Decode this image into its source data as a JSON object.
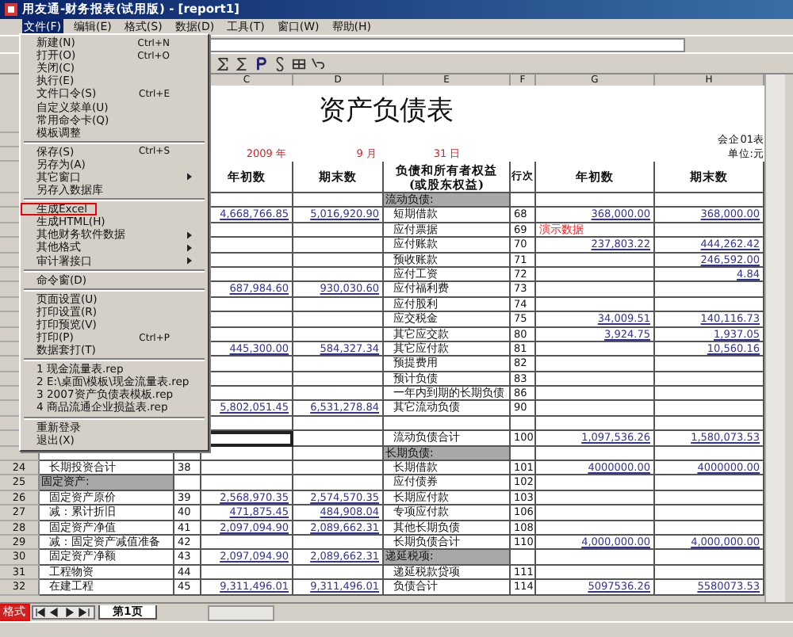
{
  "window": {
    "title": "用友通-财务报表(试用版) - [report1]"
  },
  "menubar": [
    {
      "label": "文件(F)",
      "selected": true
    },
    {
      "label": "编辑(E)",
      "selected": false
    },
    {
      "label": "格式(S)",
      "selected": false
    },
    {
      "label": "数据(D)",
      "selected": false
    },
    {
      "label": "工具(T)",
      "selected": false
    },
    {
      "label": "窗口(W)",
      "selected": false
    },
    {
      "label": "帮助(H)",
      "selected": false
    }
  ],
  "file_menu": [
    {
      "kind": "item",
      "label": "新建(N)",
      "shortcut": "Ctrl+N",
      "submenu": false,
      "highlighted": false
    },
    {
      "kind": "item",
      "label": "打开(O)",
      "shortcut": "Ctrl+O",
      "submenu": false,
      "highlighted": false
    },
    {
      "kind": "item",
      "label": "关闭(C)",
      "submenu": false,
      "highlighted": false
    },
    {
      "kind": "item",
      "label": "执行(E)",
      "submenu": false,
      "highlighted": false
    },
    {
      "kind": "item",
      "label": "文件口令(S)",
      "shortcut": "Ctrl+E",
      "submenu": false,
      "highlighted": false
    },
    {
      "kind": "item",
      "label": "自定义菜单(U)",
      "submenu": false,
      "highlighted": false
    },
    {
      "kind": "item",
      "label": "常用命令卡(Q)",
      "submenu": false,
      "highlighted": false
    },
    {
      "kind": "item",
      "label": "模板调整",
      "submenu": false,
      "highlighted": false
    },
    {
      "kind": "separator"
    },
    {
      "kind": "item",
      "label": "保存(S)",
      "shortcut": "Ctrl+S",
      "submenu": false,
      "highlighted": false
    },
    {
      "kind": "item",
      "label": "另存为(A)",
      "submenu": false,
      "highlighted": false
    },
    {
      "kind": "item",
      "label": "其它窗口",
      "submenu": true,
      "highlighted": false
    },
    {
      "kind": "item",
      "label": "另存入数据库",
      "submenu": false,
      "highlighted": false
    },
    {
      "kind": "separator"
    },
    {
      "kind": "item",
      "label": "生成Excel",
      "submenu": false,
      "highlighted": true
    },
    {
      "kind": "item",
      "label": "生成HTML(H)",
      "submenu": false,
      "highlighted": false
    },
    {
      "kind": "item",
      "label": "其他财务软件数据",
      "submenu": true,
      "highlighted": false
    },
    {
      "kind": "item",
      "label": "其他格式",
      "submenu": true,
      "highlighted": false
    },
    {
      "kind": "item",
      "label": "审计署接口",
      "submenu": true,
      "highlighted": false
    },
    {
      "kind": "separator"
    },
    {
      "kind": "item",
      "label": "命令窗(D)",
      "submenu": false,
      "highlighted": false
    },
    {
      "kind": "separator"
    },
    {
      "kind": "item",
      "label": "页面设置(U)",
      "submenu": false,
      "highlighted": false
    },
    {
      "kind": "item",
      "label": "打印设置(R)",
      "submenu": false,
      "highlighted": false
    },
    {
      "kind": "item",
      "label": "打印预览(V)",
      "submenu": false,
      "highlighted": false
    },
    {
      "kind": "item",
      "label": "打印(P)",
      "shortcut": "Ctrl+P",
      "submenu": false,
      "highlighted": false
    },
    {
      "kind": "item",
      "label": "数据套打(T)",
      "submenu": false,
      "highlighted": false
    },
    {
      "kind": "separator"
    },
    {
      "kind": "item",
      "label": "1 现金流量表.rep",
      "submenu": false,
      "highlighted": false
    },
    {
      "kind": "item",
      "label": "2 E:\\桌面\\模板\\现金流量表.rep",
      "submenu": false,
      "highlighted": false
    },
    {
      "kind": "item",
      "label": "3 2007资产负债表模板.rep",
      "submenu": false,
      "highlighted": false
    },
    {
      "kind": "item",
      "label": "4 商品流通企业损益表.rep",
      "submenu": false,
      "highlighted": false
    },
    {
      "kind": "separator"
    },
    {
      "kind": "item",
      "label": "重新登录",
      "submenu": false,
      "highlighted": false
    },
    {
      "kind": "item",
      "label": "退出(X)",
      "submenu": false,
      "highlighted": false
    }
  ],
  "column_headers": [
    "C",
    "D",
    "E",
    "F",
    "G",
    "H"
  ],
  "report": {
    "title": "资产负债表",
    "form_no": "会企01表",
    "year": "2009 年",
    "month": "9 月",
    "day": "31 日",
    "unit": "单位:元",
    "headers": [
      "年初数",
      "期末数",
      "负债和所有者权益",
      "(或股东权益)",
      "行次",
      "年初数",
      "期末数"
    ]
  },
  "rows": [
    {
      "cells": [
        null,
        null,
        null,
        null,
        {
          "kind": "section",
          "text": "流动负债:"
        },
        null,
        null,
        null
      ]
    },
    {
      "cells": [
        null,
        null,
        {
          "kind": "value",
          "text": "4,668,766.85"
        },
        {
          "kind": "value",
          "text": "5,016,920.90"
        },
        {
          "kind": "name",
          "text": "短期借款"
        },
        {
          "kind": "line",
          "text": "68"
        },
        {
          "kind": "value",
          "text": "368,000.00"
        },
        {
          "kind": "value",
          "text": "368,000.00"
        }
      ]
    },
    {
      "cells": [
        null,
        null,
        null,
        null,
        {
          "kind": "name",
          "text": "应付票据"
        },
        {
          "kind": "line",
          "text": "69"
        },
        {
          "kind": "note",
          "text": "演示数据"
        },
        null
      ]
    },
    {
      "cells": [
        null,
        null,
        null,
        null,
        {
          "kind": "name",
          "text": "应付账款"
        },
        {
          "kind": "line",
          "text": "70"
        },
        {
          "kind": "value",
          "text": "237,803.22"
        },
        {
          "kind": "value",
          "text": "444,262.42"
        }
      ]
    },
    {
      "cells": [
        null,
        null,
        null,
        null,
        {
          "kind": "name",
          "text": "预收账款"
        },
        {
          "kind": "line",
          "text": "71"
        },
        null,
        {
          "kind": "value",
          "text": "246,592.00"
        }
      ]
    },
    {
      "cells": [
        null,
        null,
        null,
        null,
        {
          "kind": "name",
          "text": "应付工资"
        },
        {
          "kind": "line",
          "text": "72"
        },
        null,
        {
          "kind": "value",
          "text": "4.84"
        }
      ]
    },
    {
      "cells": [
        null,
        null,
        {
          "kind": "value",
          "text": "687,984.60"
        },
        {
          "kind": "value",
          "text": "930,030.60"
        },
        {
          "kind": "name",
          "text": "应付福利费"
        },
        {
          "kind": "line",
          "text": "73"
        },
        null,
        null
      ]
    },
    {
      "cells": [
        null,
        null,
        null,
        null,
        {
          "kind": "name",
          "text": "应付股利"
        },
        {
          "kind": "line",
          "text": "74"
        },
        null,
        null
      ]
    },
    {
      "cells": [
        null,
        null,
        null,
        null,
        {
          "kind": "name",
          "text": "应交税金"
        },
        {
          "kind": "line",
          "text": "75"
        },
        {
          "kind": "value",
          "text": "34,009.51"
        },
        {
          "kind": "value",
          "text": "140,116.73"
        }
      ]
    },
    {
      "cells": [
        null,
        null,
        null,
        null,
        {
          "kind": "name",
          "text": "其它应交款"
        },
        {
          "kind": "line",
          "text": "80"
        },
        {
          "kind": "value",
          "text": "3,924.75"
        },
        {
          "kind": "value",
          "text": "1,937.05"
        }
      ]
    },
    {
      "cells": [
        null,
        null,
        {
          "kind": "value",
          "text": "445,300.00"
        },
        {
          "kind": "value",
          "text": "584,327.34"
        },
        {
          "kind": "name",
          "text": "其它应付款"
        },
        {
          "kind": "line",
          "text": "81"
        },
        null,
        {
          "kind": "value",
          "text": "10,560.16"
        }
      ]
    },
    {
      "cells": [
        null,
        null,
        null,
        null,
        {
          "kind": "name",
          "text": "预提费用"
        },
        {
          "kind": "line",
          "text": "82"
        },
        null,
        null
      ]
    },
    {
      "cells": [
        null,
        null,
        null,
        null,
        {
          "kind": "name",
          "text": "预计负债"
        },
        {
          "kind": "line",
          "text": "83"
        },
        null,
        null
      ]
    },
    {
      "cells": [
        null,
        null,
        null,
        null,
        {
          "kind": "name",
          "text": "一年内到期的长期负债"
        },
        {
          "kind": "line",
          "text": "86"
        },
        null,
        null
      ]
    },
    {
      "cells": [
        null,
        null,
        {
          "kind": "value",
          "text": "5,802,051.45"
        },
        {
          "kind": "value",
          "text": "6,531,278.84"
        },
        {
          "kind": "name",
          "text": "其它流动负债"
        },
        {
          "kind": "line",
          "text": "90"
        },
        null,
        null
      ]
    },
    {
      "cells": [
        null,
        null,
        null,
        null,
        null,
        null,
        null,
        null
      ]
    },
    {
      "cells": [
        null,
        null,
        {
          "kind": "blank",
          "selected": true
        },
        null,
        {
          "kind": "name",
          "text": "流动负债合计"
        },
        {
          "kind": "line",
          "text": "100"
        },
        {
          "kind": "value",
          "text": "1,097,536.26"
        },
        {
          "kind": "value",
          "text": "1,580,073.53"
        }
      ]
    },
    {
      "cells": [
        null,
        null,
        null,
        null,
        {
          "kind": "section",
          "text": "长期负债:"
        },
        null,
        null,
        null
      ]
    },
    {
      "num": "24",
      "cells": [
        {
          "kind": "name",
          "text": "长期投资合计"
        },
        {
          "kind": "line",
          "text": "38"
        },
        null,
        null,
        {
          "kind": "name",
          "text": "长期借款"
        },
        {
          "kind": "line",
          "text": "101"
        },
        {
          "kind": "value",
          "text": "4000000.00"
        },
        {
          "kind": "value",
          "text": "4000000.00"
        }
      ]
    },
    {
      "num": "25",
      "cells": [
        {
          "kind": "section",
          "text": "固定资产:"
        },
        null,
        null,
        null,
        {
          "kind": "name",
          "text": "应付债券"
        },
        {
          "kind": "line",
          "text": "102"
        },
        null,
        null
      ]
    },
    {
      "num": "26",
      "cells": [
        {
          "kind": "name",
          "text": "固定资产原价"
        },
        {
          "kind": "line",
          "text": "39"
        },
        {
          "kind": "value",
          "text": "2,568,970.35"
        },
        {
          "kind": "value",
          "text": "2,574,570.35"
        },
        {
          "kind": "name",
          "text": "长期应付款"
        },
        {
          "kind": "line",
          "text": "103"
        },
        null,
        null
      ]
    },
    {
      "num": "27",
      "cells": [
        {
          "kind": "name",
          "text": "减：累计折旧"
        },
        {
          "kind": "line",
          "text": "40"
        },
        {
          "kind": "value",
          "text": "471,875.45"
        },
        {
          "kind": "value",
          "text": "484,908.04"
        },
        {
          "kind": "name",
          "text": "专项应付款"
        },
        {
          "kind": "line",
          "text": "106"
        },
        null,
        null
      ]
    },
    {
      "num": "28",
      "cells": [
        {
          "kind": "name",
          "text": "固定资产净值"
        },
        {
          "kind": "line",
          "text": "41"
        },
        {
          "kind": "value",
          "text": "2,097,094.90"
        },
        {
          "kind": "value",
          "text": "2,089,662.31"
        },
        {
          "kind": "name",
          "text": "其他长期负债"
        },
        {
          "kind": "line",
          "text": "108"
        },
        null,
        null
      ]
    },
    {
      "num": "29",
      "cells": [
        {
          "kind": "name",
          "text": "减：固定资产减值准备"
        },
        {
          "kind": "line",
          "text": "42"
        },
        null,
        null,
        {
          "kind": "name",
          "text": "长期负债合计"
        },
        {
          "kind": "line",
          "text": "110"
        },
        {
          "kind": "value",
          "text": "4,000,000.00"
        },
        {
          "kind": "value",
          "text": "4,000,000.00"
        }
      ]
    },
    {
      "num": "30",
      "cells": [
        {
          "kind": "name",
          "text": "固定资产净额"
        },
        {
          "kind": "line",
          "text": "43"
        },
        {
          "kind": "value",
          "text": "2,097,094.90"
        },
        {
          "kind": "value",
          "text": "2,089,662.31"
        },
        {
          "kind": "section",
          "text": "递延税项:"
        },
        null,
        null,
        null
      ]
    },
    {
      "num": "31",
      "cells": [
        {
          "kind": "name",
          "text": "工程物资"
        },
        {
          "kind": "line",
          "text": "44"
        },
        null,
        null,
        {
          "kind": "name",
          "text": "递延税款贷项"
        },
        {
          "kind": "line",
          "text": "111"
        },
        null,
        null
      ]
    },
    {
      "num": "32",
      "cells": [
        {
          "kind": "name",
          "text": "在建工程"
        },
        {
          "kind": "line",
          "text": "45"
        },
        {
          "kind": "value",
          "text": "9,311,496.01"
        },
        {
          "kind": "value",
          "text": "9,311,496.01"
        },
        {
          "kind": "name",
          "text": "负债合计"
        },
        {
          "kind": "line",
          "text": "114"
        },
        {
          "kind": "value",
          "text": "5097536.26"
        },
        {
          "kind": "value",
          "text": "5580073.53"
        }
      ]
    }
  ],
  "mode_button": {
    "label": "格式",
    "highlighted": true
  },
  "sheet_tabs": [
    {
      "label": "第1页",
      "selected": true
    }
  ]
}
